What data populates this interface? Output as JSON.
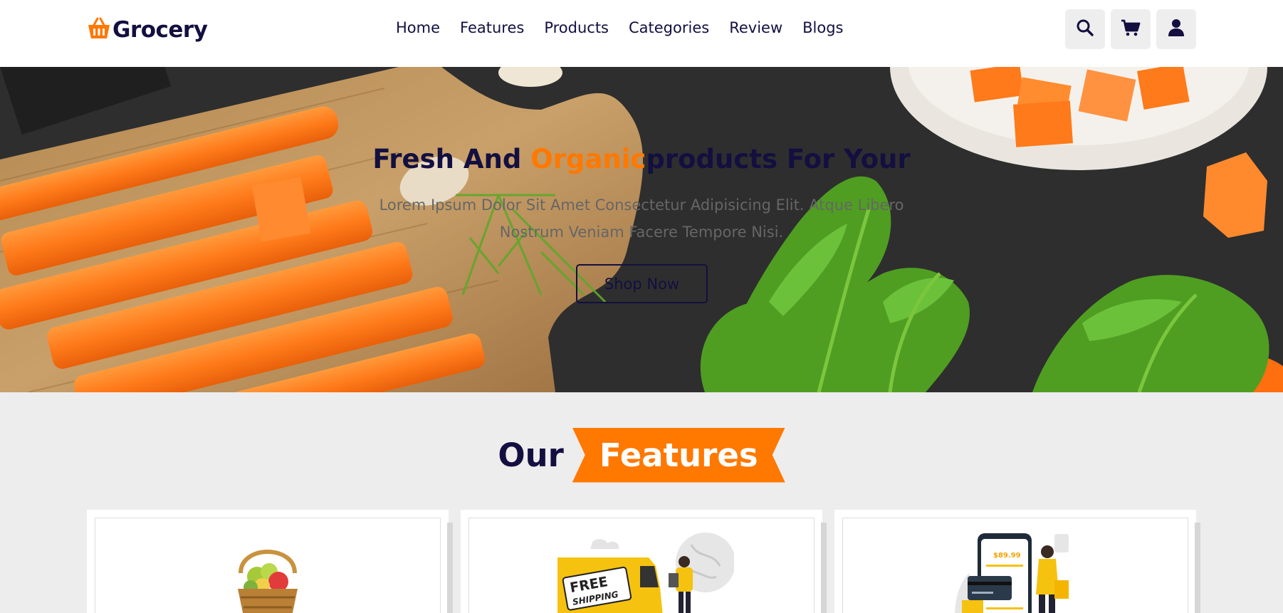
{
  "header": {
    "logo_text": "Grocery",
    "nav": [
      "Home",
      "Features",
      "Products",
      "Categories",
      "Review",
      "Blogs"
    ],
    "icons": [
      "search-icon",
      "cart-icon",
      "user-icon"
    ]
  },
  "hero": {
    "title_part1": "Fresh And ",
    "title_accent": "Organic",
    "title_part2": "products For Your",
    "description": "Lorem Ipsum Dolor Sit Amet Consectetur Adipisicing Elit. Atque Libero Nostrum Veniam Facere Tempore Nisi.",
    "button_label": "Shop Now"
  },
  "features": {
    "heading_part1": "Our",
    "heading_part2": "Features",
    "card_illustrations": [
      "fruit-basket",
      "free-shipping",
      "mobile-payment"
    ],
    "shipping_badge_line1": "FREE",
    "shipping_badge_line2": "SHIPPING",
    "payment_price": "$89.99"
  },
  "colors": {
    "primary": "#130f40",
    "accent": "#ff7800",
    "background": "#ededed"
  }
}
